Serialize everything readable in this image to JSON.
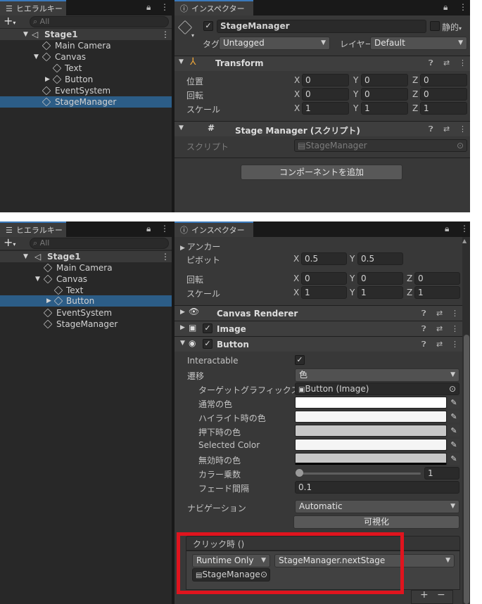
{
  "top": {
    "hierarchy": {
      "tab": "ヒエラルキー",
      "search_placeholder": "All",
      "scene": "Stage1",
      "items": [
        "Main Camera",
        "Canvas",
        "Text",
        "Button",
        "EventSystem",
        "StageManager"
      ],
      "selected": "StageManager"
    },
    "inspector": {
      "tab": "インスペクター",
      "object_name": "StageManager",
      "static_label": "静的",
      "tag_label": "タグ",
      "tag_value": "Untagged",
      "layer_label": "レイヤー",
      "layer_value": "Default",
      "transform": {
        "title": "Transform",
        "rows": [
          {
            "label": "位置",
            "x": "0",
            "y": "0",
            "z": "0"
          },
          {
            "label": "回転",
            "x": "0",
            "y": "0",
            "z": "0"
          },
          {
            "label": "スケール",
            "x": "1",
            "y": "1",
            "z": "1"
          }
        ]
      },
      "script_component": {
        "title": "Stage Manager (スクリプト)",
        "script_label": "スクリプト",
        "script_value": "StageManager"
      },
      "add_component": "コンポーネントを追加"
    }
  },
  "bottom": {
    "hierarchy": {
      "tab": "ヒエラルキー",
      "search_placeholder": "All",
      "scene": "Stage1",
      "items": [
        "Main Camera",
        "Canvas",
        "Text",
        "Button",
        "EventSystem",
        "StageManager"
      ],
      "selected": "Button"
    },
    "inspector": {
      "tab": "インスペクター",
      "anchor_label": "アンカー",
      "pivot": {
        "label": "ピボット",
        "x": "0.5",
        "y": "0.5"
      },
      "rotation": {
        "label": "回転",
        "x": "0",
        "y": "0",
        "z": "0"
      },
      "scale": {
        "label": "スケール",
        "x": "1",
        "y": "1",
        "z": "1"
      },
      "components": [
        "Canvas Renderer",
        "Image",
        "Button"
      ],
      "button": {
        "interactable_label": "Interactable",
        "transition_label": "遷移",
        "transition_value": "色",
        "target_graphic_label": "ターゲットグラフィックス",
        "target_graphic_value": "Button (Image)",
        "colors": [
          {
            "label": "通常の色",
            "color": "#ffffff"
          },
          {
            "label": "ハイライト時の色",
            "color": "#f5f5f5"
          },
          {
            "label": "押下時の色",
            "color": "#c8c8c8"
          },
          {
            "label": "Selected Color",
            "color": "#f5f5f5"
          },
          {
            "label": "無効時の色",
            "color": "#c8c8c8"
          }
        ],
        "color_multiplier_label": "カラー乗数",
        "color_multiplier_value": "1",
        "fade_label": "フェード間隔",
        "fade_value": "0.1",
        "navigation_label": "ナビゲーション",
        "navigation_value": "Automatic",
        "visualize_label": "可視化"
      },
      "onclick": {
        "title": "クリック時 ()",
        "runtime": "Runtime Only",
        "function": "StageManager.nextStage",
        "object": "StageManage",
        "plus": "+",
        "minus": "−"
      }
    }
  },
  "colors": {
    "selection": "#2c5d87",
    "highlight_box": "#e0141e",
    "panel_bg": "#282828",
    "header_bg": "#3e3e3e"
  }
}
